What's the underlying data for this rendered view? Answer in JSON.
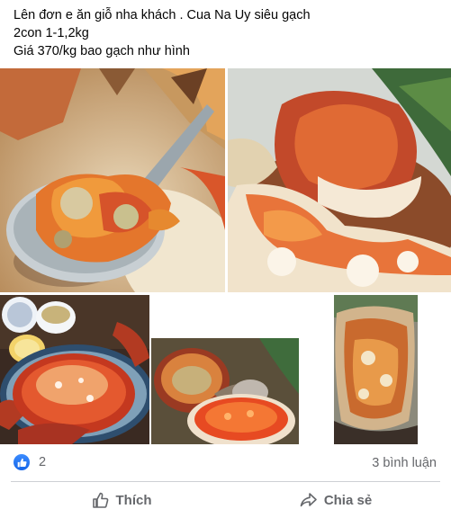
{
  "post": {
    "lines": [
      "Lên đơn e ăn giỗ nha khách . Cua Na Uy siêu gạch",
      "2con 1-1,2kg",
      "Giá 370/kg bao gạch như hình"
    ]
  },
  "stats": {
    "reaction_count": "2",
    "comments_label": "3 bình luận"
  },
  "actions": {
    "like_label": "Thích",
    "share_label": "Chia sẻ"
  },
  "icons": {
    "reaction": "like-badge-icon",
    "like": "thumbs-up-icon",
    "share": "share-arrow-icon"
  },
  "colors": {
    "accent": "#1877f2",
    "muted_text": "#65676b",
    "divider": "#ced0d4"
  }
}
